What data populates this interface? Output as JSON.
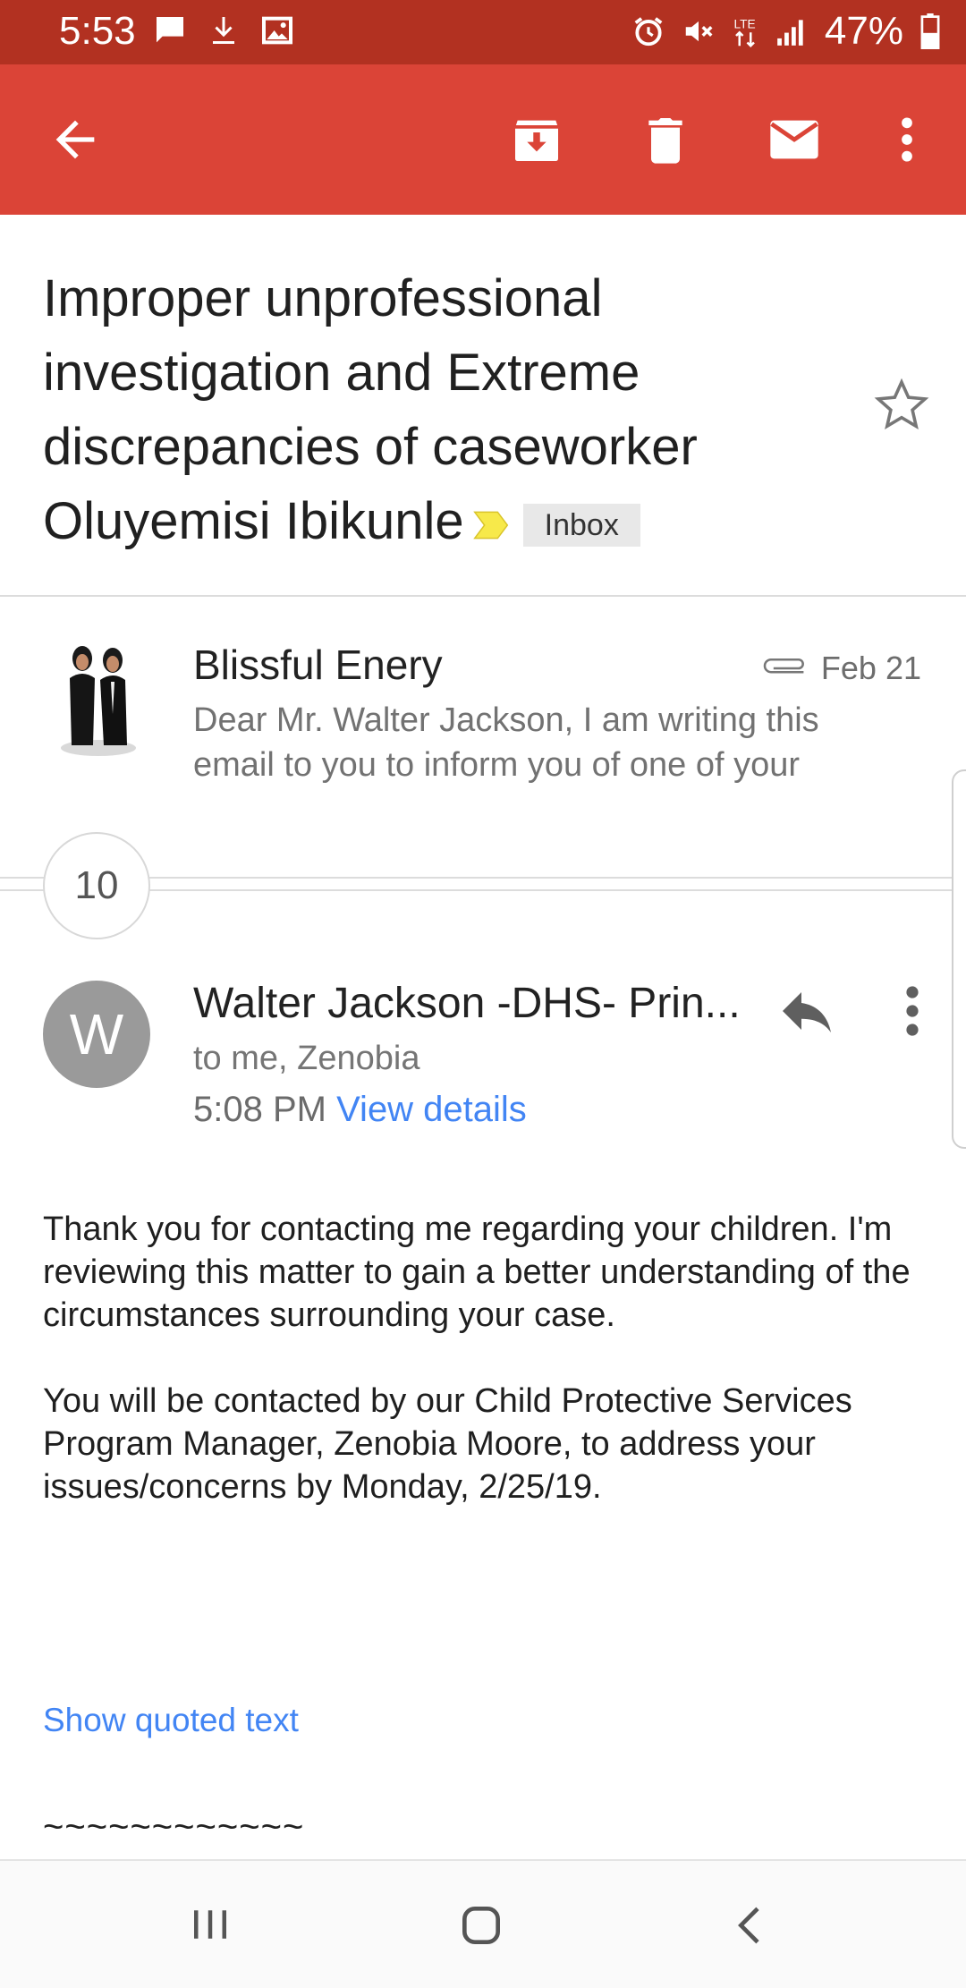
{
  "status_bar": {
    "time": "5:53",
    "battery": "47%",
    "icons": [
      "chat-icon",
      "download-icon",
      "image-icon",
      "alarm-icon",
      "mute-icon",
      "data-icon",
      "signal-icon",
      "battery-icon"
    ]
  },
  "toolbar": {
    "icons": [
      "back-arrow-icon",
      "archive-icon",
      "delete-icon",
      "mark-unread-icon",
      "more-vert-icon"
    ],
    "color": "#db4437"
  },
  "subject": {
    "text": "Improper unprofessional investigation and Extreme discrepancies of caseworker Oluyemisi Ibikunle",
    "label": "Inbox",
    "important_color": "#f7e94a"
  },
  "message_collapsed": {
    "sender": "Blissful Enery",
    "date": "Feb 21",
    "has_attachment": true,
    "snippet": "Dear Mr. Walter Jackson, I am writing this email to you to inform you of one of your"
  },
  "hidden_count": "10",
  "message_expanded": {
    "avatar_letter": "W",
    "sender": "Walter Jackson -DHS- Prin...",
    "recipients": "to me, Zenobia",
    "time": "5:08 PM",
    "details_link": "View details",
    "body": [
      "Thank you for contacting me regarding your children. I'm reviewing this matter to gain a better understanding of the circumstances surrounding your case.",
      "You will be contacted by our Child Protective Services Program Manager, Zenobia Moore, to address your issues/concerns by Monday, 2/25/19."
    ],
    "show_quoted": "Show quoted text",
    "signature": "~~~~~~~~~~~~"
  },
  "nav_bar": {
    "icons": [
      "recent-apps-icon",
      "home-icon",
      "back-icon"
    ]
  }
}
